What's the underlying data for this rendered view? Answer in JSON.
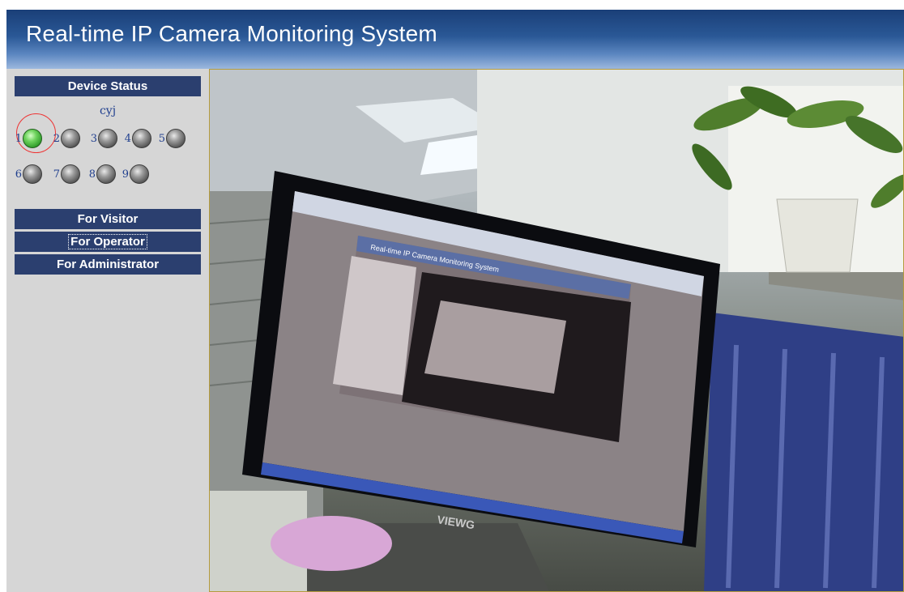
{
  "header": {
    "title": "Real-time IP Camera Monitoring System"
  },
  "sidebar": {
    "device_status_label": "Device Status",
    "device_name": "cyj",
    "cameras": [
      {
        "number": "1",
        "status": "online",
        "color": "#3fb036"
      },
      {
        "number": "2",
        "status": "offline",
        "color": "#7d7d7d"
      },
      {
        "number": "3",
        "status": "offline",
        "color": "#7d7d7d"
      },
      {
        "number": "4",
        "status": "offline",
        "color": "#7d7d7d"
      },
      {
        "number": "5",
        "status": "offline",
        "color": "#7d7d7d"
      },
      {
        "number": "6",
        "status": "offline",
        "color": "#7d7d7d"
      },
      {
        "number": "7",
        "status": "offline",
        "color": "#7d7d7d"
      },
      {
        "number": "8",
        "status": "offline",
        "color": "#7d7d7d"
      },
      {
        "number": "9",
        "status": "offline",
        "color": "#7d7d7d"
      }
    ],
    "links": {
      "visitor": "For Visitor",
      "operator": "For Operator",
      "administrator": "For Administrator"
    }
  },
  "video": {
    "monitor_brand": "VIEWG",
    "inner_title": "Real-time IP Camera Monitoring System"
  },
  "colors": {
    "header_dark": "#1a3f78",
    "sidebar_bg": "#d6d6d6",
    "bar_bg": "#2b3f6f",
    "camera_number": "#21408f"
  }
}
